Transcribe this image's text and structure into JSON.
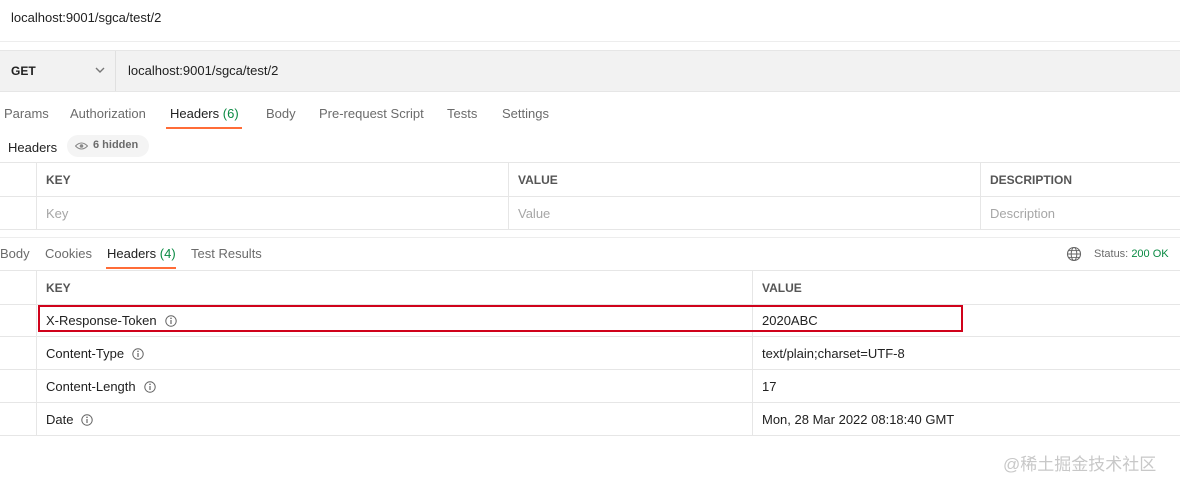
{
  "window": {
    "title": "localhost:9001/sgca/test/2"
  },
  "request": {
    "method": "GET",
    "url": "localhost:9001/sgca/test/2",
    "tabs": [
      {
        "label": "Params",
        "count": ""
      },
      {
        "label": "Authorization",
        "count": ""
      },
      {
        "label": "Headers",
        "count": "(6)"
      },
      {
        "label": "Body",
        "count": ""
      },
      {
        "label": "Pre-request Script",
        "count": ""
      },
      {
        "label": "Tests",
        "count": ""
      },
      {
        "label": "Settings",
        "count": ""
      }
    ],
    "active_tab": "Headers",
    "headers_section": {
      "label": "Headers",
      "hidden_label": "6 hidden"
    },
    "headers_table": {
      "columns": [
        "KEY",
        "VALUE",
        "DESCRIPTION"
      ],
      "placeholders": {
        "key": "Key",
        "value": "Value",
        "description": "Description"
      }
    }
  },
  "response": {
    "tabs": [
      {
        "label": "Body",
        "count": ""
      },
      {
        "label": "Cookies",
        "count": ""
      },
      {
        "label": "Headers",
        "count": "(4)"
      },
      {
        "label": "Test Results",
        "count": ""
      }
    ],
    "active_tab": "Headers",
    "status_label": "Status:",
    "status_value": "200 OK",
    "headers_table": {
      "columns": [
        "KEY",
        "VALUE"
      ],
      "rows": [
        {
          "key": "X-Response-Token",
          "value": "2020ABC"
        },
        {
          "key": "Content-Type",
          "value": "text/plain;charset=UTF-8"
        },
        {
          "key": "Content-Length",
          "value": "17"
        },
        {
          "key": "Date",
          "value": "Mon, 28 Mar 2022 08:18:40 GMT"
        }
      ]
    }
  },
  "watermark": "@稀土掘金技术社区",
  "colors": {
    "accent_tab": "#ff6c37",
    "status_ok": "#0a8a43",
    "highlight": "#d0021b"
  }
}
